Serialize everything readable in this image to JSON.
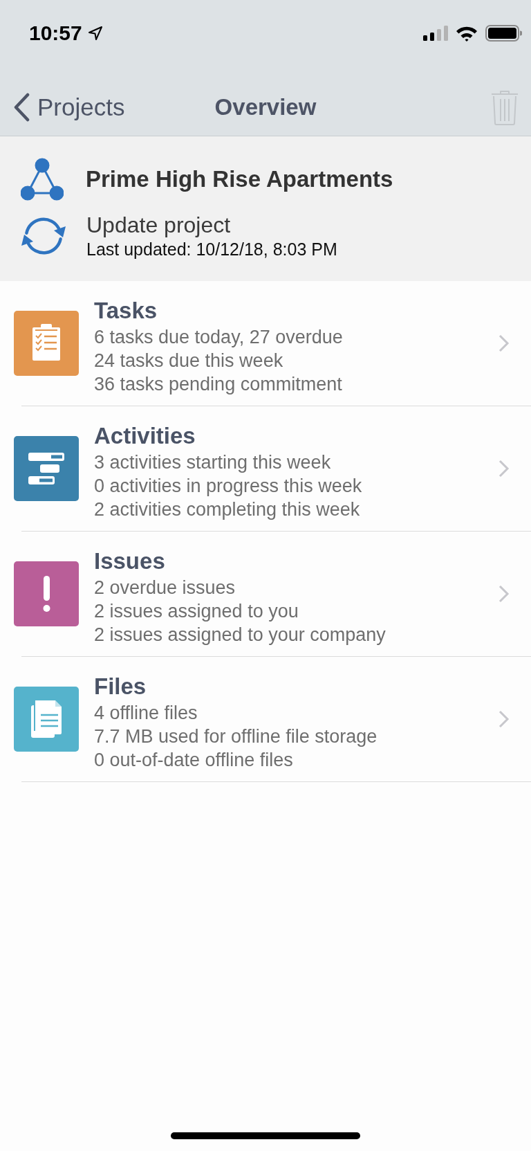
{
  "status_bar": {
    "time": "10:57"
  },
  "nav_bar": {
    "back_label": "Projects",
    "title": "Overview",
    "delete_disabled": true
  },
  "project": {
    "name": "Prime High Rise Apartments",
    "update_label": "Update project",
    "last_updated": "Last updated: 10/12/18, 8:03 PM"
  },
  "sections": [
    {
      "kind": "tasks",
      "title": "Tasks",
      "color": "#e3964f",
      "lines": [
        "6 tasks due today, 27 overdue",
        "24 tasks due this week",
        "36 tasks pending commitment"
      ]
    },
    {
      "kind": "activities",
      "title": "Activities",
      "color": "#3b82ab",
      "lines": [
        "3 activities starting this week",
        "0 activities in progress this week",
        "2 activities completing this week"
      ]
    },
    {
      "kind": "issues",
      "title": "Issues",
      "color": "#b95e98",
      "lines": [
        "2 overdue issues",
        "2 issues assigned to you",
        "2 issues assigned to your company"
      ]
    },
    {
      "kind": "files",
      "title": "Files",
      "color": "#55b3cc",
      "lines": [
        "4 offline files",
        "7.7 MB used for offline file storage",
        "0 out-of-date offline files"
      ]
    }
  ]
}
